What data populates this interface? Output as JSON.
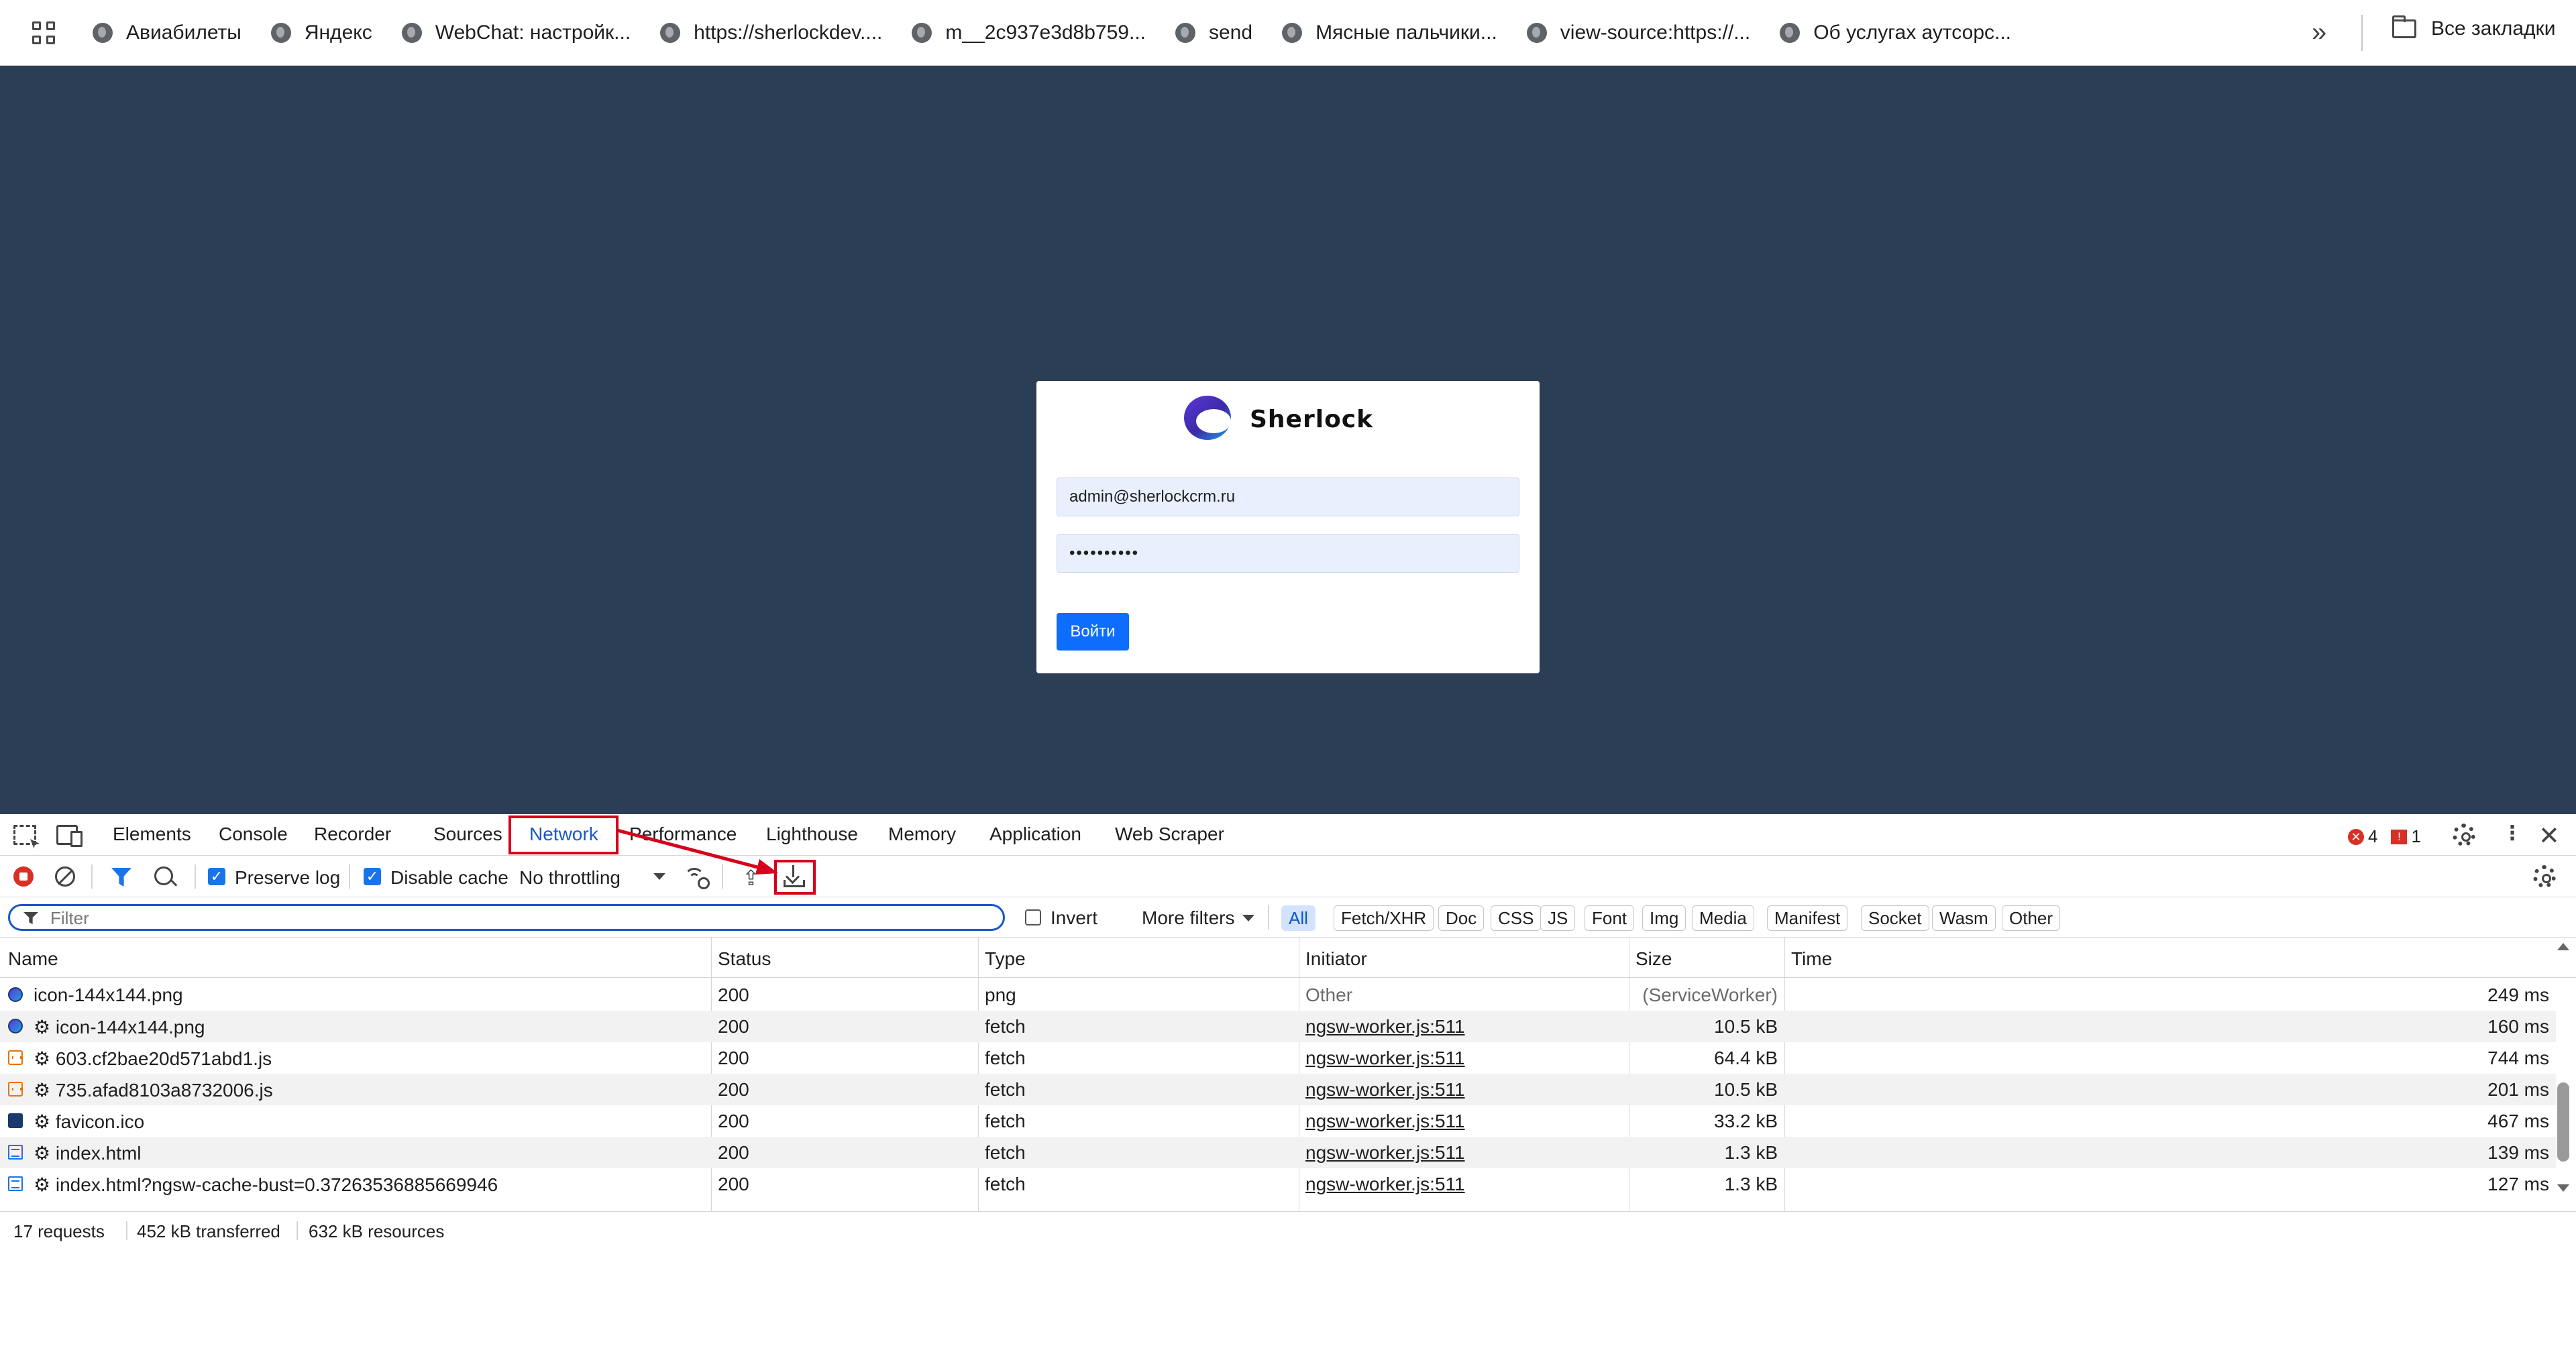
{
  "bookmarks": {
    "items": [
      "Авиабилеты",
      "Яндекс",
      "WebChat: настройк...",
      "https://sherlockdev....",
      "m__2c937e3d8b759...",
      "send",
      "Мясные пальчики...",
      "view-source:https://...",
      "Об услугах аутсорс..."
    ],
    "all_bookmarks": "Все закладки"
  },
  "login": {
    "brand": "Sherlock",
    "email": "admin@sherlockcrm.ru",
    "password": "••••••••••",
    "submit": "Войти"
  },
  "devtools": {
    "tabs": [
      "Elements",
      "Console",
      "Recorder",
      "Sources",
      "Network",
      "Performance",
      "Lighthouse",
      "Memory",
      "Application",
      "Web Scraper"
    ],
    "active_tab": "Network",
    "errors": "4",
    "warnings": "1",
    "toolbar": {
      "preserve_log": "Preserve log",
      "disable_cache": "Disable cache",
      "throttling": "No throttling"
    },
    "filter": {
      "placeholder": "Filter",
      "invert": "Invert",
      "more_filters": "More filters",
      "chips": [
        "All",
        "Fetch/XHR",
        "Doc",
        "CSS",
        "JS",
        "Font",
        "Img",
        "Media",
        "Manifest",
        "Socket",
        "Wasm",
        "Other"
      ]
    },
    "columns": [
      "Name",
      "Status",
      "Type",
      "Initiator",
      "Size",
      "Time"
    ],
    "rows": [
      {
        "icon": "img",
        "name": "icon-144x144.png",
        "status": "200",
        "type": "png",
        "initiator": "Other",
        "size": "(ServiceWorker)",
        "time": "249 ms"
      },
      {
        "icon": "img",
        "name": "⚙ icon-144x144.png",
        "status": "200",
        "type": "fetch",
        "initiator": "ngsw-worker.js:511",
        "size": "10.5 kB",
        "time": "160 ms"
      },
      {
        "icon": "js",
        "name": "⚙ 603.cf2bae20d571abd1.js",
        "status": "200",
        "type": "fetch",
        "initiator": "ngsw-worker.js:511",
        "size": "64.4 kB",
        "time": "744 ms"
      },
      {
        "icon": "js",
        "name": "⚙ 735.afad8103a8732006.js",
        "status": "200",
        "type": "fetch",
        "initiator": "ngsw-worker.js:511",
        "size": "10.5 kB",
        "time": "201 ms"
      },
      {
        "icon": "ico",
        "name": "⚙ favicon.ico",
        "status": "200",
        "type": "fetch",
        "initiator": "ngsw-worker.js:511",
        "size": "33.2 kB",
        "time": "467 ms"
      },
      {
        "icon": "doc",
        "name": "⚙ index.html",
        "status": "200",
        "type": "fetch",
        "initiator": "ngsw-worker.js:511",
        "size": "1.3 kB",
        "time": "139 ms"
      },
      {
        "icon": "doc",
        "name": "⚙ index.html?ngsw-cache-bust=0.37263536885669946",
        "status": "200",
        "type": "fetch",
        "initiator": "ngsw-worker.js:511",
        "size": "1.3 kB",
        "time": "127 ms"
      }
    ],
    "status": {
      "requests": "17 requests",
      "transferred": "452 kB transferred",
      "resources": "632 kB resources"
    }
  },
  "colors": {
    "page_bg": "#2b3e55",
    "accent": "#1a57c8",
    "button": "#0d6efd",
    "annotation": "#d6001c"
  }
}
